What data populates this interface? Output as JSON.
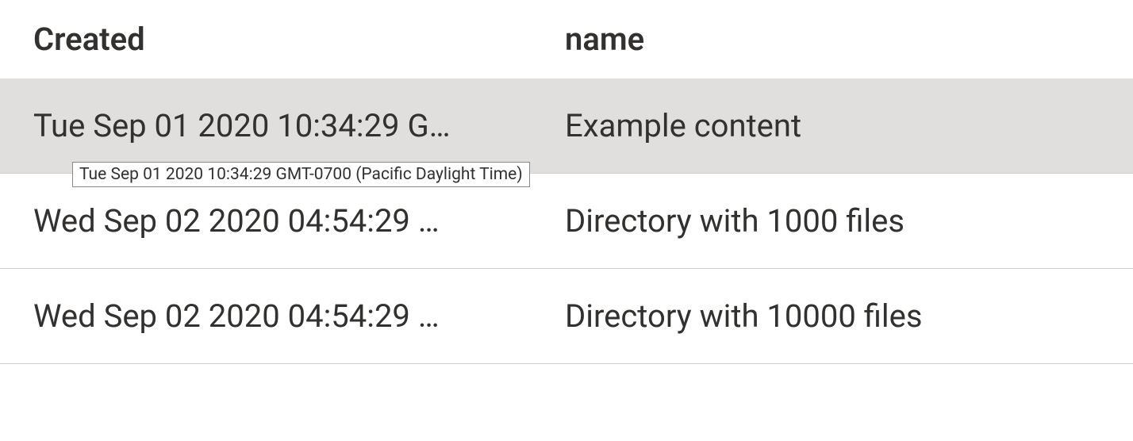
{
  "table": {
    "columns": {
      "created": "Created",
      "name": "name"
    },
    "rows": [
      {
        "created": "Tue Sep 01 2020 10:34:29 G…",
        "created_full": "Tue Sep 01 2020 10:34:29 GMT-0700 (Pacific Daylight Time)",
        "name": "Example content"
      },
      {
        "created": "Wed Sep 02 2020 04:54:29 …",
        "name": "Directory with 1000 files"
      },
      {
        "created": "Wed Sep 02 2020 04:54:29 …",
        "name": "Directory with 10000 files"
      }
    ]
  }
}
